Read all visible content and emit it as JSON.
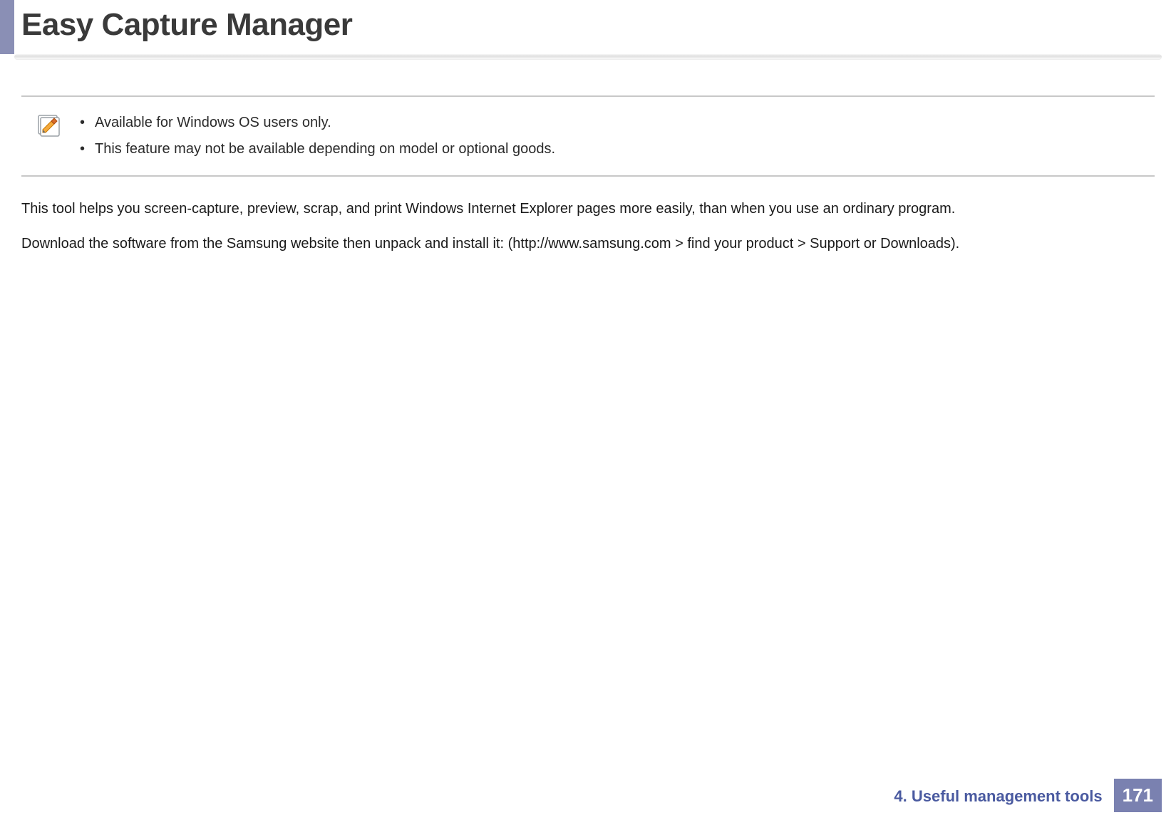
{
  "header": {
    "title": "Easy Capture Manager"
  },
  "note": {
    "items": [
      "Available for Windows OS users only.",
      "This feature may not be available depending on model or optional goods."
    ]
  },
  "body": {
    "paragraphs": [
      "This tool helps you screen-capture, preview, scrap, and print Windows Internet Explorer pages more easily, than when you use an ordinary program.",
      "Download the software from the Samsung website then unpack and install it: (http://www.samsung.com > find your product > Support or Downloads)."
    ]
  },
  "footer": {
    "chapter": "4.  Useful management tools",
    "page": "171"
  },
  "colors": {
    "accent": "#8a8fb5",
    "footer_link": "#4a5aa0",
    "page_badge": "#7a81b0"
  }
}
